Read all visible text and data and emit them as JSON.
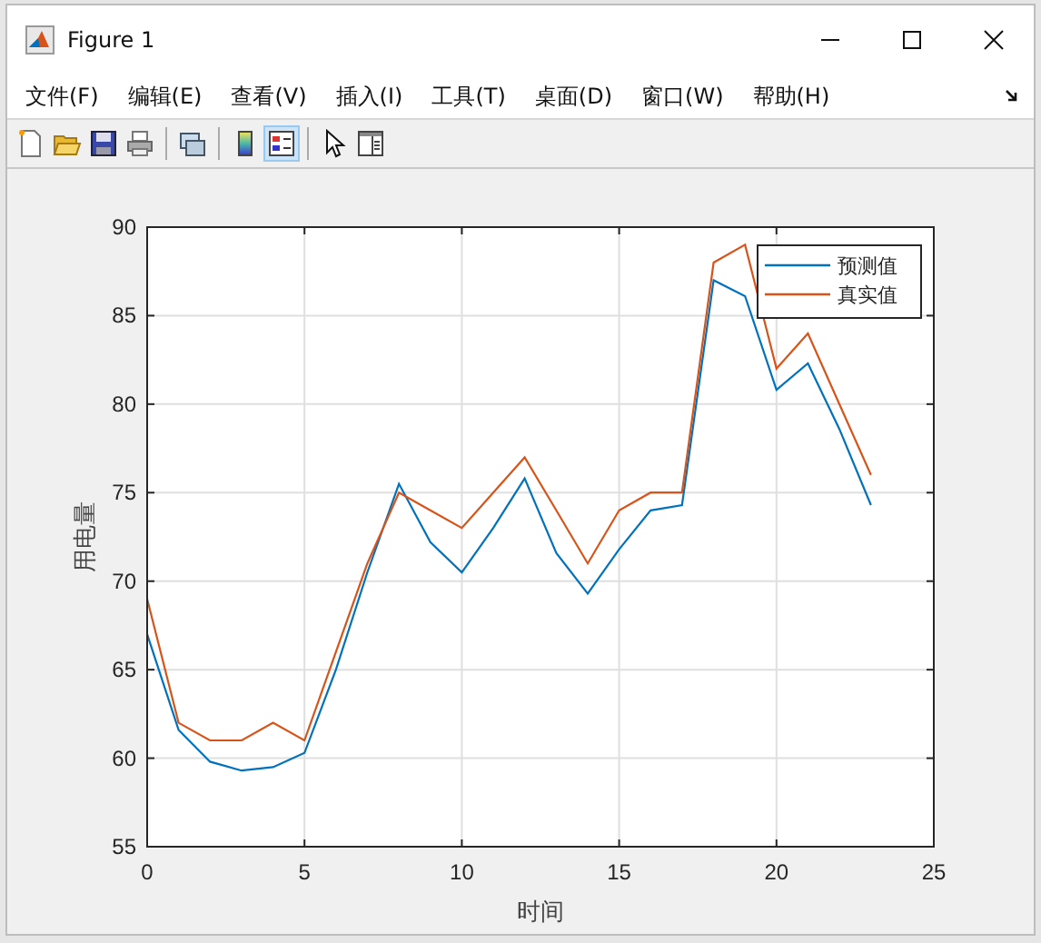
{
  "window": {
    "title": "Figure 1"
  },
  "menu": [
    {
      "label": "文件(F)"
    },
    {
      "label": "编辑(E)"
    },
    {
      "label": "查看(V)"
    },
    {
      "label": "插入(I)"
    },
    {
      "label": "工具(T)"
    },
    {
      "label": "桌面(D)"
    },
    {
      "label": "窗口(W)"
    },
    {
      "label": "帮助(H)"
    }
  ],
  "toolbar": [
    {
      "kind": "new",
      "selected": false
    },
    {
      "kind": "open",
      "selected": false
    },
    {
      "kind": "save",
      "selected": false
    },
    {
      "kind": "print",
      "selected": false
    },
    {
      "kind": "sep"
    },
    {
      "kind": "link",
      "selected": false
    },
    {
      "kind": "sep"
    },
    {
      "kind": "colorbar",
      "selected": false
    },
    {
      "kind": "legend",
      "selected": true
    },
    {
      "kind": "sep"
    },
    {
      "kind": "pointer",
      "selected": false
    },
    {
      "kind": "inspector",
      "selected": false
    }
  ],
  "figure": {
    "chart_data": {
      "type": "line",
      "xlabel": "时间",
      "ylabel": "用电量",
      "x": [
        0,
        1,
        2,
        3,
        4,
        5,
        6,
        7,
        8,
        9,
        10,
        11,
        12,
        13,
        14,
        15,
        16,
        17,
        18,
        19,
        20,
        21,
        22,
        23
      ],
      "grid": true,
      "legend": true,
      "xlim": [
        0,
        25
      ],
      "ylim": [
        55,
        90
      ],
      "xticks": [
        0,
        5,
        10,
        15,
        20,
        25
      ],
      "yticks": [
        55,
        60,
        65,
        70,
        75,
        80,
        85,
        90
      ],
      "series": [
        {
          "name": "预测值",
          "color": "#0072bd",
          "values": [
            67,
            61.6,
            59.8,
            59.3,
            59.5,
            60.3,
            65,
            70.5,
            75.5,
            72.2,
            70.5,
            73,
            75.8,
            71.6,
            69.3,
            71.8,
            74,
            74.3,
            87,
            86.1,
            80.8,
            82.3,
            78.6,
            74.3
          ]
        },
        {
          "name": "真实值",
          "color": "#d95319",
          "values": [
            69,
            62,
            61,
            61,
            62,
            61,
            66,
            71,
            75,
            74,
            73,
            75,
            77,
            74,
            71,
            74,
            75,
            75,
            88,
            89,
            82,
            84,
            80,
            76
          ]
        }
      ]
    }
  }
}
